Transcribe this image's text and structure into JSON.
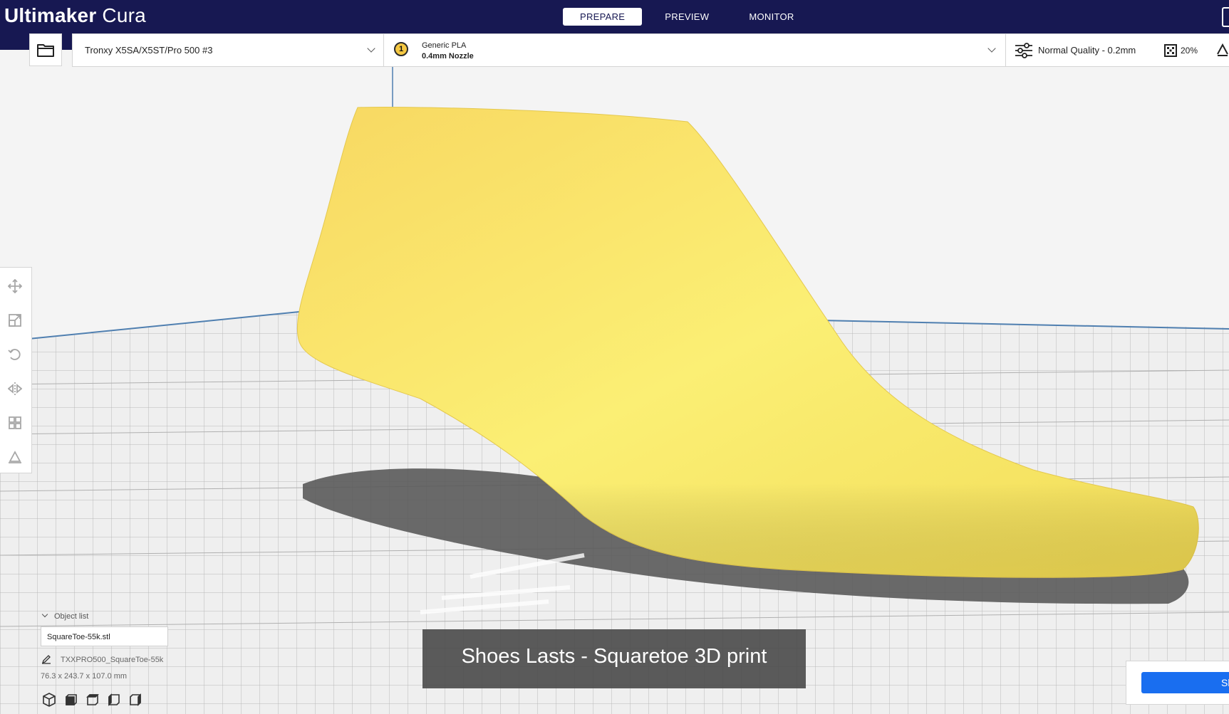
{
  "app": {
    "brand_bold": "Ultimaker",
    "brand_light": "Cura"
  },
  "stages": [
    {
      "label": "PREPARE",
      "active": true
    },
    {
      "label": "PREVIEW",
      "active": false
    },
    {
      "label": "MONITOR",
      "active": false
    }
  ],
  "printer": {
    "name": "Tronxy X5SA/X5ST/Pro 500 #3"
  },
  "extruder": {
    "number": "1",
    "material": "Generic PLA",
    "nozzle": "0.4mm Nozzle"
  },
  "print_settings": {
    "quality": "Normal Quality - 0.2mm",
    "infill": "20%"
  },
  "tools": [
    "move-icon",
    "scale-icon",
    "rotate-icon",
    "mirror-icon",
    "per-model-settings-icon",
    "support-blocker-icon"
  ],
  "object_list": {
    "header": "Object list",
    "items": [
      "SquareToe-55k.stl"
    ],
    "job_name": "TXXPRO500_SquareToe-55k",
    "dimensions": "76.3 x 243.7 x 107.0 mm"
  },
  "view_buttons": [
    "3d-view-icon",
    "front-view-icon",
    "top-view-icon",
    "left-view-icon",
    "right-view-icon"
  ],
  "caption": "Shoes Lasts - Squaretoe 3D print",
  "slice_button": "Slice",
  "colors": {
    "header": "#171852",
    "model": "#f5e063",
    "accent": "#196ef0"
  }
}
